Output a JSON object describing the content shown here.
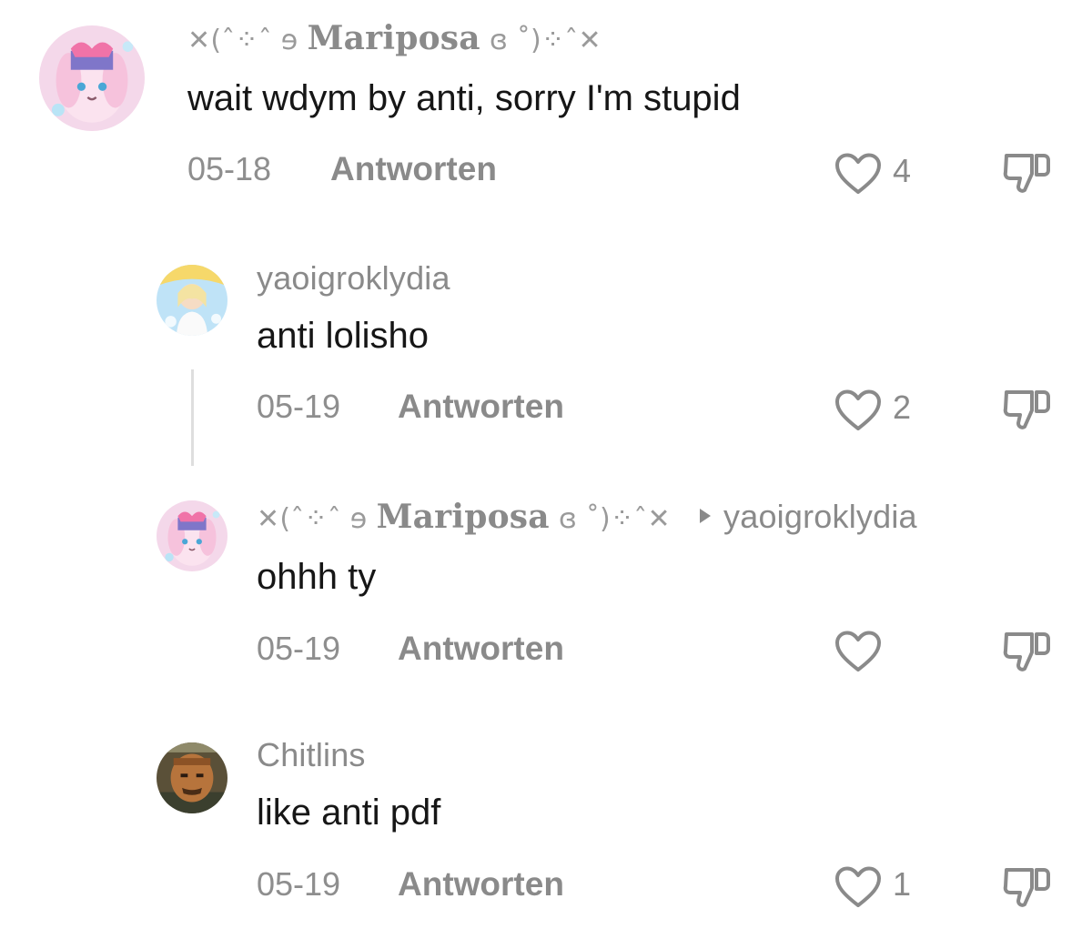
{
  "comments": [
    {
      "user_prefix": "✕(ˆ⁘ˆ ɘ",
      "user_name": "Mariposa",
      "user_suffix": "ɞ ˚)⁘ˆ✕",
      "text": "wait wdym by anti, sorry I'm stupid",
      "date": "05-18",
      "reply_label": "Antworten",
      "likes": "4"
    },
    {
      "user_name": "yaoigroklydia",
      "text": "anti lolisho",
      "date": "05-19",
      "reply_label": "Antworten",
      "likes": "2"
    },
    {
      "user_prefix": "✕(ˆ⁘ˆ ɘ",
      "user_name": "Mariposa",
      "user_suffix": "ɞ ˚)⁘ˆ✕",
      "reply_to": "yaoigroklydia",
      "text": "ohhh ty",
      "date": "05-19",
      "reply_label": "Antworten",
      "likes": ""
    },
    {
      "user_name": "Chitlins",
      "text": "like anti pdf",
      "date": "05-19",
      "reply_label": "Antworten",
      "likes": "1"
    }
  ],
  "icons": {
    "like": "heart-outline-icon",
    "dislike": "thumbs-down-outline-icon"
  },
  "colors": {
    "meta_gray": "#8a8a8a",
    "text": "#161616",
    "thread_line": "#dedede"
  }
}
